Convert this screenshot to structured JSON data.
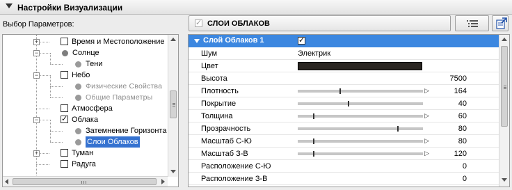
{
  "panel": {
    "title": "Настройки Визуализации"
  },
  "params_label": "Выбор Параметров:",
  "tree": {
    "items": [
      {
        "label": "Время и Местоположение",
        "kind": "cb",
        "checked": false,
        "expander": "+",
        "indent": 1
      },
      {
        "label": "Солнце",
        "kind": "dot",
        "expander": "−",
        "indent": 1
      },
      {
        "label": "Тени",
        "kind": "dot",
        "indent": 2
      },
      {
        "label": "Небо",
        "kind": "cb",
        "checked": false,
        "expander": "−",
        "indent": 1
      },
      {
        "label": "Физические Свойства",
        "kind": "dot",
        "indent": 2,
        "disabled": true
      },
      {
        "label": "Общие Параметры",
        "kind": "dot",
        "indent": 2,
        "disabled": true
      },
      {
        "label": "Атмосфера",
        "kind": "cb",
        "checked": false,
        "indent": 1
      },
      {
        "label": "Облака",
        "kind": "cb",
        "checked": true,
        "expander": "−",
        "indent": 1
      },
      {
        "label": "Затемнение Горизонта",
        "kind": "dot",
        "indent": 2
      },
      {
        "label": "Слои Облаков",
        "kind": "dot",
        "indent": 2,
        "selected": true
      },
      {
        "label": "Туман",
        "kind": "cb",
        "checked": false,
        "expander": "+",
        "indent": 1
      },
      {
        "label": "Радуга",
        "kind": "cb",
        "checked": false,
        "indent": 1
      }
    ]
  },
  "selector": {
    "title": "СЛОИ ОБЛАКОВ",
    "checked": true
  },
  "grid": {
    "header": {
      "label": "Слой Облаков 1",
      "checked": true
    },
    "rows": [
      {
        "name": "Шум",
        "text": "Электрик"
      },
      {
        "name": "Цвет",
        "color": "#2a2622"
      },
      {
        "name": "Высота",
        "value": "7500"
      },
      {
        "name": "Плотность",
        "value": "164",
        "slider": 0.33,
        "arrow": true
      },
      {
        "name": "Покрытие",
        "value": "40",
        "slider": 0.4
      },
      {
        "name": "Толщина",
        "value": "60",
        "slider": 0.12,
        "arrow": true
      },
      {
        "name": "Прозрачность",
        "value": "80",
        "slider": 0.8
      },
      {
        "name": "Масштаб С-Ю",
        "value": "80",
        "slider": 0.12,
        "arrow": true
      },
      {
        "name": "Масштаб З-В",
        "value": "120",
        "slider": 0.12,
        "arrow": true
      },
      {
        "name": "Расположение С-Ю",
        "value": "0"
      },
      {
        "name": "Расположение З-В",
        "value": "0"
      }
    ]
  },
  "colors": {
    "selection": "#3572d0",
    "header_blue": "#3c87e0"
  }
}
